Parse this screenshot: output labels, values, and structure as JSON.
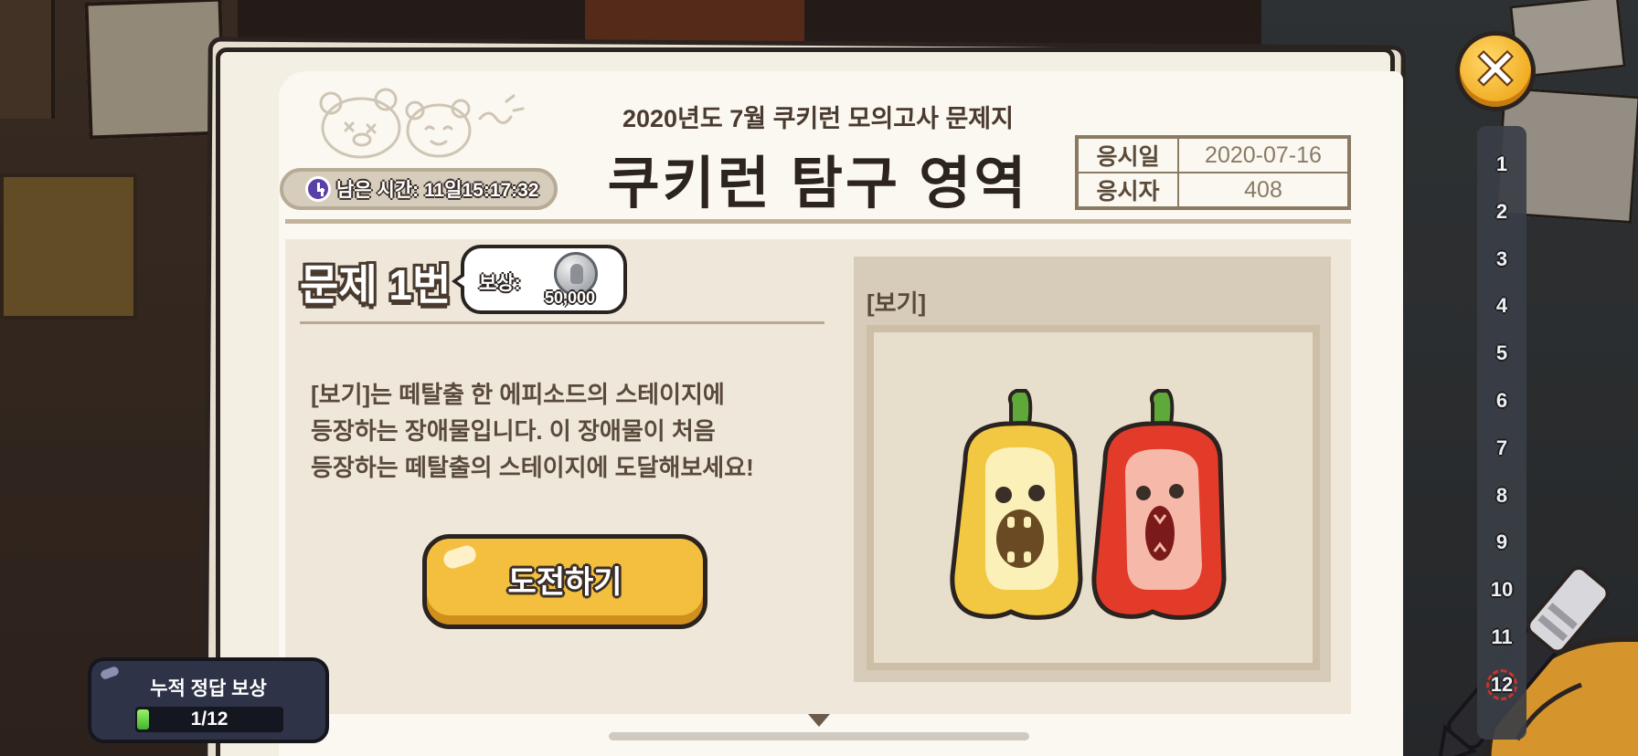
{
  "exam": {
    "subtitle": "2020년도 7월 쿠키런 모의고사 문제지",
    "title": "쿠키런 탐구 영역",
    "timer_text": "남은 시간: 11일15:17:32",
    "info": {
      "date_label": "응시일",
      "date_value": "2020-07-16",
      "taker_label": "응시자",
      "taker_value": "408"
    }
  },
  "question": {
    "number_label": "문제 1번",
    "reward_label": "보상:",
    "reward_amount": "50,000",
    "text": "[보기]는 떼탈출 한 에피소드의 스테이지에\n등장하는 장애물입니다. 이 장애물이 처음\n등장하는 떼탈출의 스테이지에 도달해보세요!",
    "button_label": "도전하기",
    "view_label": "[보기]",
    "view_icon": "bell-pepper-obstacles-icon"
  },
  "accumulated": {
    "title": "누적 정답 보상",
    "progress_text": "1/12",
    "progress_fraction": 0.0833
  },
  "question_list": {
    "items": [
      "1",
      "2",
      "3",
      "4",
      "5",
      "6",
      "7",
      "8",
      "9",
      "10",
      "11",
      "12"
    ],
    "current_index": 11
  },
  "close_icon": "close-icon",
  "colors": {
    "accent_button": "#f4bf3e",
    "paper": "#f4efe3",
    "progress_fill": "#3fb52c"
  }
}
